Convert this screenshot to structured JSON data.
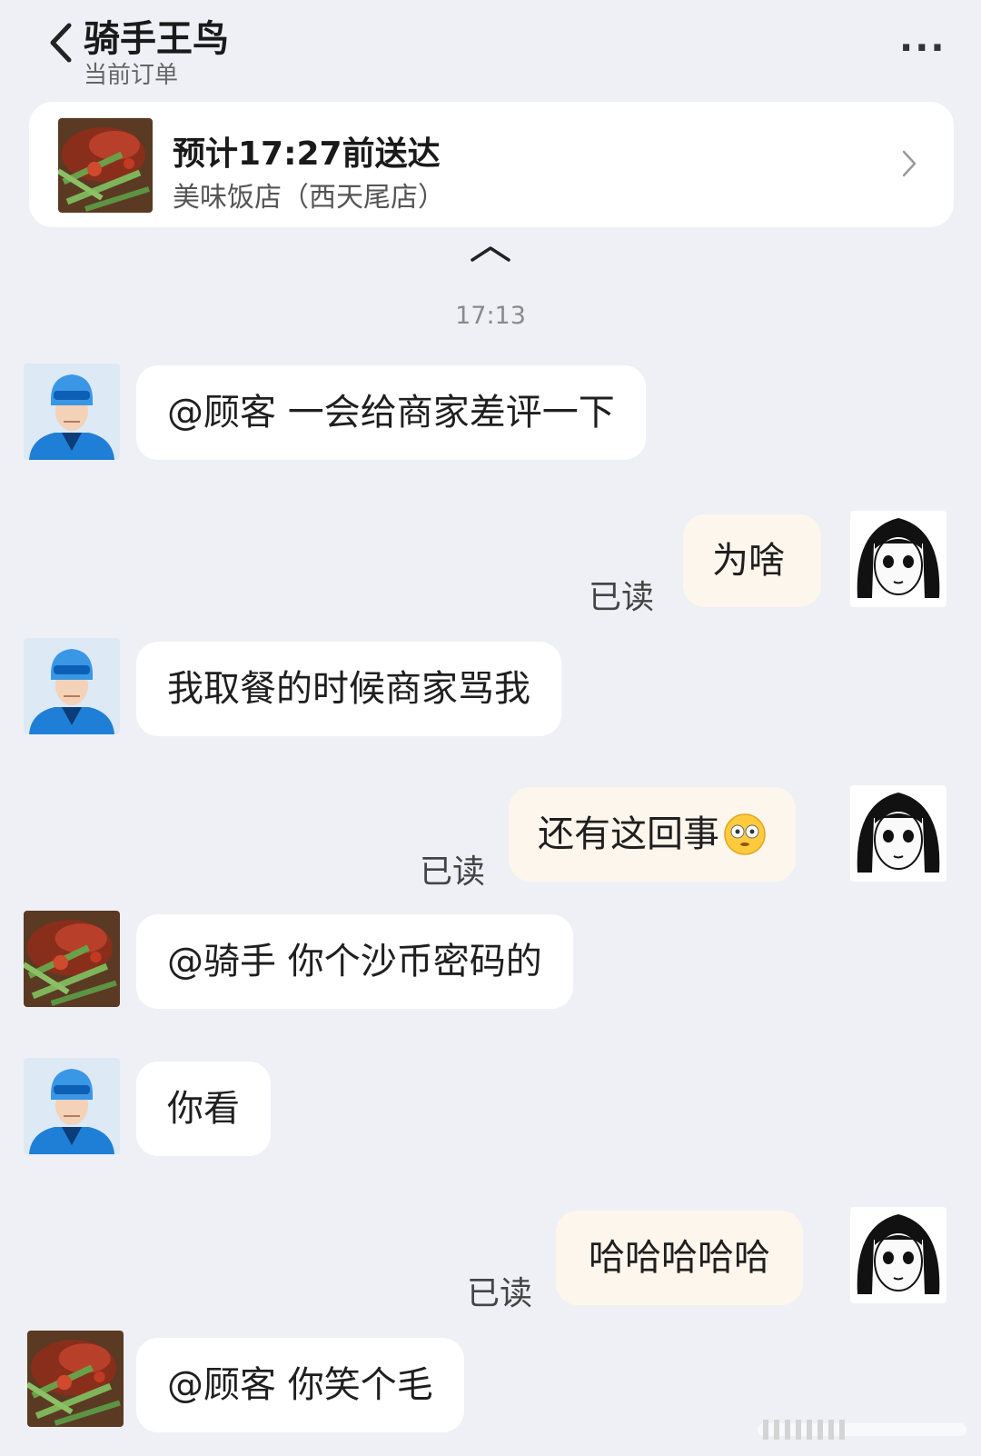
{
  "header": {
    "title": "骑手王鸟",
    "subtitle": "当前订单",
    "more_label": "···"
  },
  "order": {
    "eta": "预计17:27前送达",
    "shop": "美味饭店（西天尾店）"
  },
  "timestamp": "17:13",
  "messages": [
    {
      "sender": "rider",
      "text": "@顾客 一会给商家差评一下"
    },
    {
      "sender": "customer",
      "text": "为啥",
      "status": "已读"
    },
    {
      "sender": "rider",
      "text": "我取餐的时候商家骂我"
    },
    {
      "sender": "customer",
      "text": "还有这回事",
      "status": "已读",
      "emoji": "flushed-face-emoji"
    },
    {
      "sender": "merchant",
      "text": "@骑手 你个沙币密码的"
    },
    {
      "sender": "rider",
      "text": "你看"
    },
    {
      "sender": "customer",
      "text": "哈哈哈哈哈",
      "status": "已读"
    },
    {
      "sender": "merchant",
      "text": "@顾客 你笑个毛"
    }
  ],
  "colors": {
    "background": "#eef0f6",
    "bubble_in": "#ffffff",
    "bubble_out": "#fdf6ec",
    "rider_blue": "#2b8fe0"
  }
}
